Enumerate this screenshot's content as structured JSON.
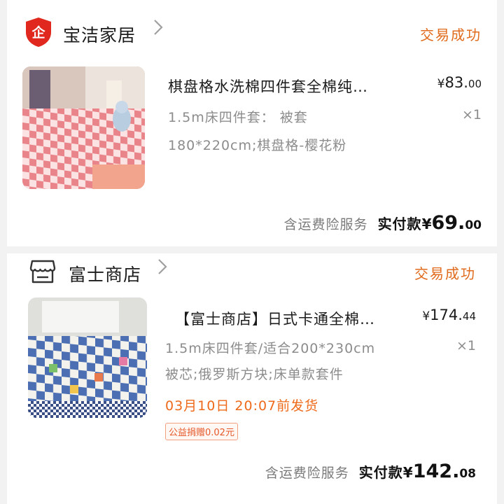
{
  "orders": [
    {
      "shop_name": "宝洁家居",
      "shop_icon": "enterprise-shield-icon",
      "shop_icon_char": "企",
      "status": "交易成功",
      "item": {
        "title": "棋盘格水洗棉四件套全棉纯…",
        "price_symbol": "¥",
        "price_int": "83.",
        "price_dec": "00",
        "spec_line1": "1.5m床四件套： 被套",
        "spec_line2": "180*220cm;棋盘格-樱花粉",
        "quantity": "×1"
      },
      "insurance": "含运费险服务",
      "paid_label": "实付款",
      "paid_symbol": "¥",
      "paid_int": "69.",
      "paid_dec": "00"
    },
    {
      "shop_name": "富士商店",
      "shop_icon": "storefront-icon",
      "status": "交易成功",
      "item": {
        "title": "【富士商店】日式卡通全棉…",
        "price_symbol": "¥",
        "price_int": "174.",
        "price_dec": "44",
        "spec_line1": "1.5m床四件套/适合200*230cm",
        "spec_line2": "被芯;俄罗斯方块;床单款套件",
        "quantity": "×1",
        "ship_time": "03月10日 20:07前发货",
        "charity_badge": "公益捐赠0.02元"
      },
      "insurance": "含运费险服务",
      "paid_label": "实付款",
      "paid_symbol": "¥",
      "paid_int": "142.",
      "paid_dec": "08"
    }
  ],
  "colors": {
    "status": "#e06b1c",
    "shield_red": "#e0281f",
    "ship_orange": "#ee6a1a",
    "background": "#f2f2f2"
  }
}
